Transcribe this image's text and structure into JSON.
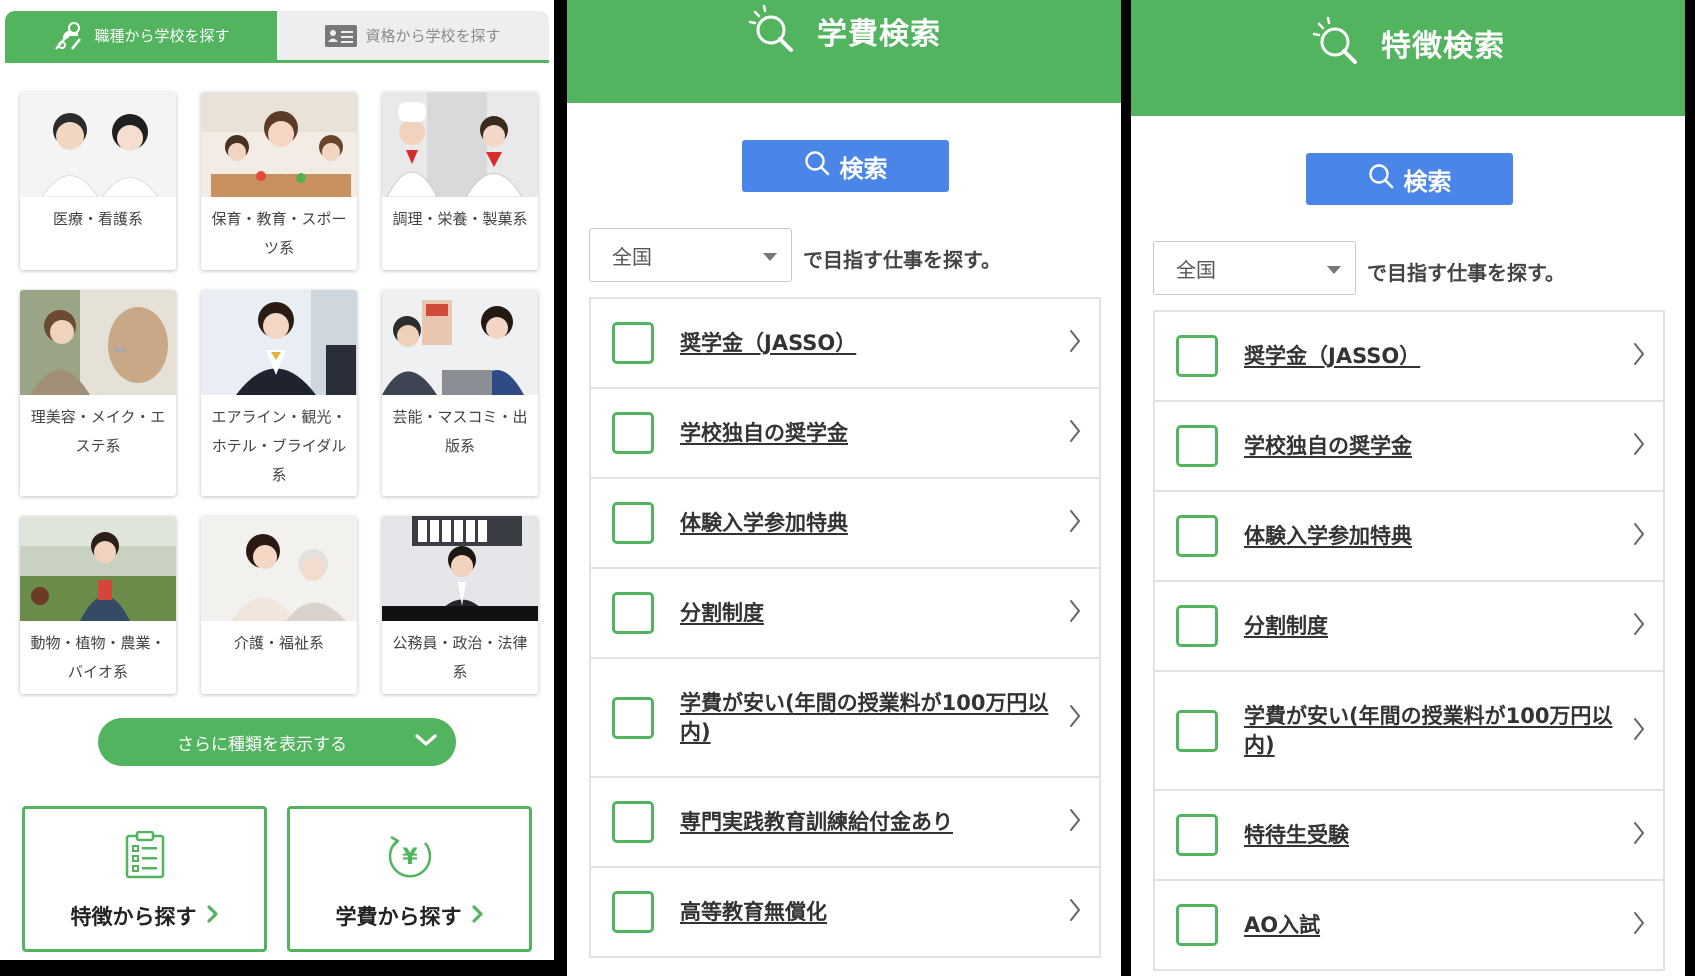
{
  "panel_career": {
    "tabs": [
      {
        "label": "職種から学校を探す",
        "icon": "chef-tools-icon",
        "active": true
      },
      {
        "label": "資格から学校を探す",
        "icon": "id-card-icon",
        "active": false
      }
    ],
    "categories": [
      {
        "label": "医療・看護系",
        "image": "medical-staff-photo"
      },
      {
        "label": "保育・教育・スポーツ系",
        "image": "childcare-photo"
      },
      {
        "label": "調理・栄養・製菓系",
        "image": "chefs-photo"
      },
      {
        "label": "理美容・メイク・エステ系",
        "image": "hairdresser-photo"
      },
      {
        "label": "エアライン・観光・ホテル・ブライダル系",
        "image": "airline-staff-photo"
      },
      {
        "label": "芸能・マスコミ・出版系",
        "image": "media-office-photo"
      },
      {
        "label": "動物・植物・農業・バイオ系",
        "image": "greenhouse-photo"
      },
      {
        "label": "介護・福祉系",
        "image": "caregiver-photo"
      },
      {
        "label": "公務員・政治・法律系",
        "image": "office-worker-photo"
      }
    ],
    "more_button": "さらに種類を表示する",
    "feature_box": {
      "label": "特徴から探す",
      "icon": "clipboard-list-icon"
    },
    "tuition_box": {
      "label": "学費から探す",
      "icon": "yen-cycle-icon"
    }
  },
  "panel_tuition": {
    "title": "学費検索",
    "search_button": "検索",
    "region_select": "全国",
    "select_suffix": "で目指す仕事を探す。",
    "items": [
      "奨学金（JASSO）",
      "学校独自の奨学金",
      "体験入学参加特典",
      "分割制度",
      "学費が安い(年間の授業料が100万円以内)",
      "専門実践教育訓練給付金あり",
      "高等教育無償化"
    ]
  },
  "panel_feature": {
    "title": "特徴検索",
    "search_button": "検索",
    "region_select": "全国",
    "select_suffix": "で目指す仕事を探す。",
    "items": [
      "奨学金（JASSO）",
      "学校独自の奨学金",
      "体験入学参加特典",
      "分割制度",
      "学費が安い(年間の授業料が100万円以内)",
      "特待生受験",
      "AO入試"
    ]
  },
  "colors": {
    "accent_green": "#52b45e",
    "search_blue": "#4a86e8"
  }
}
